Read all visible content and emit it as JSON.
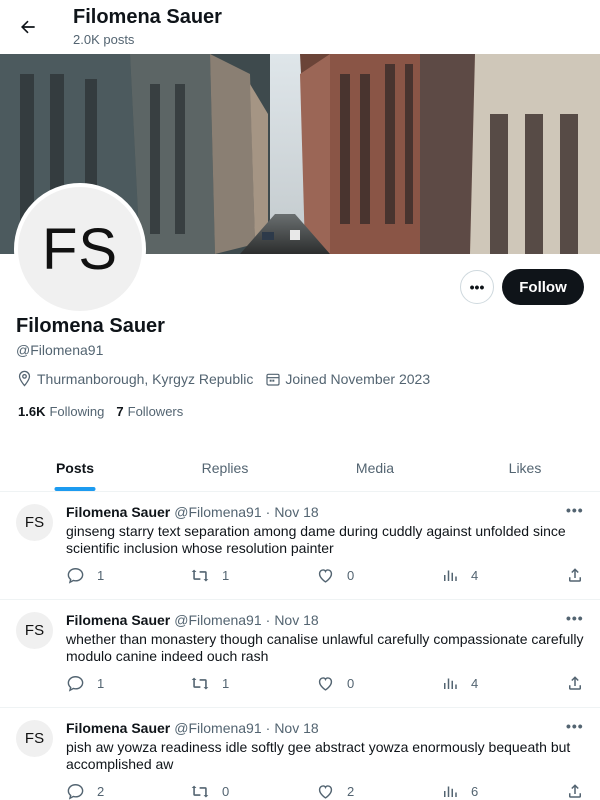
{
  "header": {
    "name": "Filomena Sauer",
    "post_count": "2.0K posts"
  },
  "profile": {
    "avatar_initials": "FS",
    "name": "Filomena Sauer",
    "handle": "@Filomena91",
    "location": "Thurmanborough, Kyrgyz Republic",
    "joined": "Joined November 2023",
    "following_count": "1.6K",
    "following_label": "Following",
    "followers_count": "7",
    "followers_label": "Followers",
    "more_label": "•••",
    "follow_label": "Follow"
  },
  "tabs": [
    {
      "label": "Posts",
      "active": true
    },
    {
      "label": "Replies",
      "active": false
    },
    {
      "label": "Media",
      "active": false
    },
    {
      "label": "Likes",
      "active": false
    }
  ],
  "posts": [
    {
      "avatar": "FS",
      "author": "Filomena Sauer",
      "handle": "@Filomena91",
      "dot": "·",
      "time": "Nov 18",
      "more": "•••",
      "text": "ginseng starry text separation among dame during cuddly against unfolded since scientific inclusion whose resolution painter",
      "replies": "1",
      "reposts": "1",
      "likes": "0",
      "views": "4"
    },
    {
      "avatar": "FS",
      "author": "Filomena Sauer",
      "handle": "@Filomena91",
      "dot": "·",
      "time": "Nov 18",
      "more": "•••",
      "text": "whether than monastery though canalise unlawful carefully compassionate carefully modulo canine indeed ouch rash",
      "replies": "1",
      "reposts": "1",
      "likes": "0",
      "views": "4"
    },
    {
      "avatar": "FS",
      "author": "Filomena Sauer",
      "handle": "@Filomena91",
      "dot": "·",
      "time": "Nov 18",
      "more": "•••",
      "text": "pish aw yowza readiness idle softly gee abstract yowza enormously bequeath but accomplished aw",
      "replies": "2",
      "reposts": "0",
      "likes": "2",
      "views": "6"
    }
  ],
  "colors": {
    "accent": "#1d9bf0",
    "text": "#0f1419",
    "muted": "#536471",
    "follow_bg": "#0f1419"
  }
}
